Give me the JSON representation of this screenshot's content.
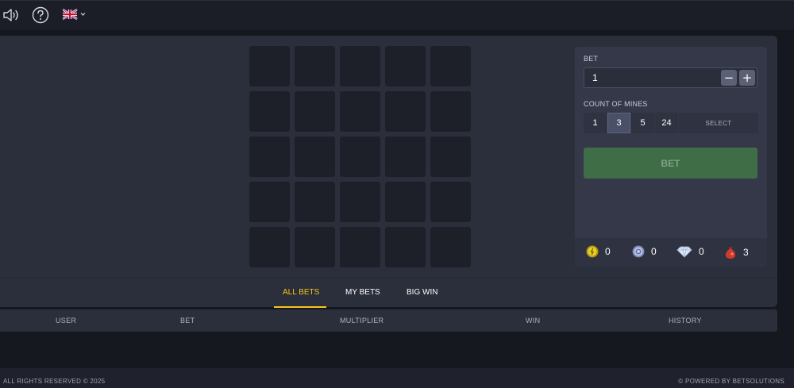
{
  "topbar": {
    "sound_icon": "speaker-icon",
    "help_icon": "question-icon",
    "language_icon": "uk-flag-icon"
  },
  "grid": {
    "rows": 5,
    "cols": 5
  },
  "panel": {
    "bet_label": "BET",
    "bet_value": "1",
    "minus_label": "−",
    "plus_label": "+",
    "mines_label": "COUNT OF MINES",
    "mine_options": [
      "1",
      "3",
      "5",
      "24"
    ],
    "selected_mines": "3",
    "select_label": "SELECT",
    "bet_button": "BET",
    "bet_button_color": "#3f6d46"
  },
  "stats": {
    "coin_gold": "0",
    "coin_silver": "0",
    "diamond": "0",
    "bag": "3"
  },
  "tabs": {
    "all_bets": "ALL BETS",
    "my_bets": "MY BETS",
    "big_win": "BIG WIN",
    "active_color": "#f5c518"
  },
  "table_header": {
    "user": "USER",
    "bet": "BET",
    "multiplier": "MULTIPLIER",
    "win": "WIN",
    "history": "HISTORY"
  },
  "footer": {
    "rights": "ALL RIGHTS RESERVED © 2025",
    "powered": "© POWERED BY BETSOLUTIONS"
  }
}
